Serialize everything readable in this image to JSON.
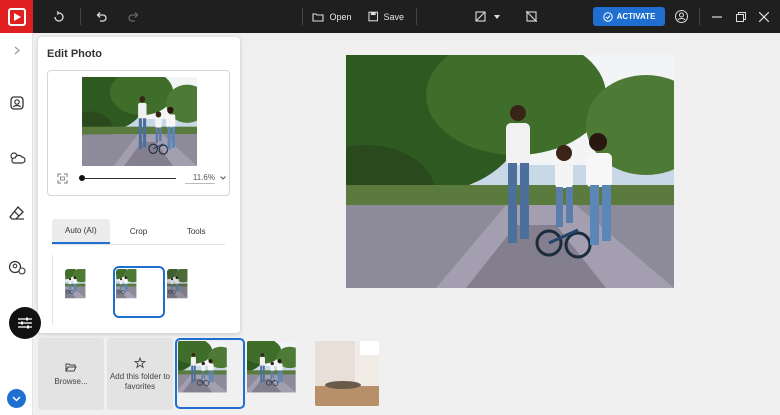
{
  "toolbar": {
    "open_label": "Open",
    "save_label": "Save",
    "activate_label": "ACTIVATE"
  },
  "panel": {
    "title": "Edit Photo",
    "zoom_value": "11.6%",
    "tabs": [
      "Auto (AI)",
      "Crop",
      "Tools"
    ]
  },
  "strip": {
    "browse_label": "Browse...",
    "favorites_label": "Add this folder to favorites"
  },
  "colors": {
    "accent": "#1f6fd1",
    "logo": "#e02020",
    "topbar": "#1f1f1f"
  }
}
